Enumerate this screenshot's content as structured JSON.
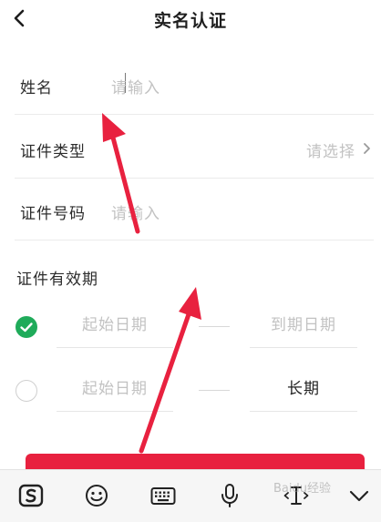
{
  "header": {
    "title": "实名认证",
    "back_icon": "chevron-left-icon"
  },
  "form": {
    "name": {
      "label": "姓名",
      "placeholder": "请输入"
    },
    "id_type": {
      "label": "证件类型",
      "placeholder": "请选择",
      "icon": "chevron-right-icon"
    },
    "id_number": {
      "label": "证件号码",
      "placeholder": "请输入"
    }
  },
  "validity": {
    "title": "证件有效期",
    "option_range": {
      "checked": true,
      "start_placeholder": "起始日期",
      "end_placeholder": "到期日期"
    },
    "option_long": {
      "checked": false,
      "start_placeholder": "起始日期",
      "end_value": "长期"
    }
  },
  "keyboard": {
    "icons": [
      "sogou-logo-icon",
      "emoji-icon",
      "keyboard-icon",
      "microphone-icon",
      "text-cursor-icon",
      "chevron-down-icon"
    ]
  },
  "watermark": "Baidu经验",
  "colors": {
    "accent": "#e8213f",
    "check": "#1fab5a",
    "placeholder": "#c2c2c2",
    "annotation": "#e8213f"
  }
}
